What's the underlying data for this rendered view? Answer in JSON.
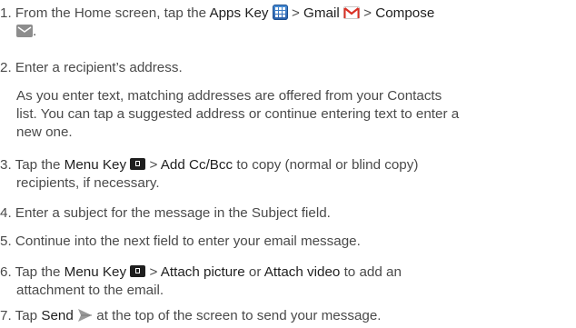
{
  "steps": [
    {
      "num": "1.",
      "l1_a": "From the Home screen, tap the ",
      "apps_key": "Apps Key",
      "sep1": " > ",
      "gmail": "Gmail",
      "sep2": " > ",
      "compose": "Compose",
      "l2_end": ".",
      "icons": [
        "apps-key-icon",
        "gmail-icon",
        "compose-icon"
      ]
    },
    {
      "num": "2.",
      "text": "Enter a recipient’s address."
    },
    {
      "para_l1": "As you enter text, matching addresses are offered from your Contacts",
      "para_l2": "list. You can tap a suggested address or continue entering text to enter a",
      "para_l3": "new one."
    },
    {
      "num": "3.",
      "l1_a": "Tap the ",
      "menu_key": "Menu Key",
      "sep": " > ",
      "add_cc": "Add Cc/Bcc",
      "l1_b": " to copy (normal or blind copy)",
      "l2": "recipients, if necessary.",
      "icons": [
        "menu-key-icon"
      ]
    },
    {
      "num": "4.",
      "text": "Enter a subject for the message in the Subject field."
    },
    {
      "num": "5.",
      "text": "Continue into the next field to enter your email message."
    },
    {
      "num": "6.",
      "l1_a": "Tap the ",
      "menu_key": "Menu Key",
      "sep": " > ",
      "attach_picture": "Attach picture",
      "or": " or ",
      "attach_video": "Attach video",
      "l1_b": " to add an",
      "l2": "attachment to the email.",
      "icons": [
        "menu-key-icon"
      ]
    },
    {
      "num": "7.",
      "l1_a": "Tap ",
      "send": "Send",
      "l1_b": " at the top of the screen to send your message.",
      "icons": [
        "send-icon"
      ]
    }
  ],
  "colors": {
    "body_text": "#4a4a4a",
    "key_text": "#1f1f1f",
    "apps_icon": "#3a78c8",
    "gmail_red": "#d93025",
    "compose_icon": "#8d8d8d",
    "menu_icon": "#1e1e1e",
    "send_icon": "#9a9a9a"
  }
}
